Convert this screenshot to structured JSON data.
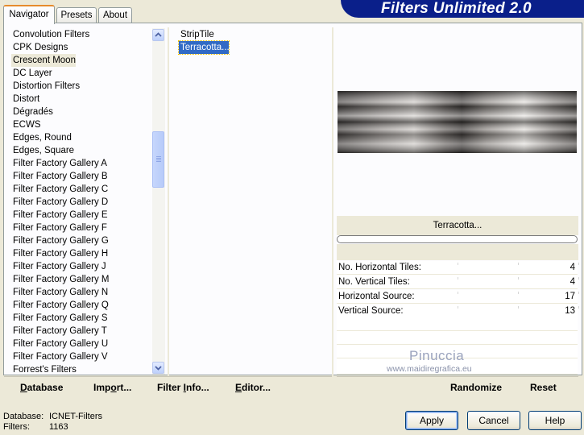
{
  "banner": {
    "title": "Filters Unlimited 2.0"
  },
  "tabs": [
    {
      "label": "Navigator",
      "active": true
    },
    {
      "label": "Presets",
      "active": false
    },
    {
      "label": "About",
      "active": false
    }
  ],
  "categories": {
    "selected": "Crescent Moon",
    "items": [
      "Convolution Filters",
      "CPK Designs",
      "Crescent Moon",
      "DC Layer",
      "Distortion Filters",
      "Distort",
      "Dégradés",
      "ECWS",
      "Edges, Round",
      "Edges, Square",
      "Filter Factory Gallery A",
      "Filter Factory Gallery B",
      "Filter Factory Gallery C",
      "Filter Factory Gallery D",
      "Filter Factory Gallery E",
      "Filter Factory Gallery F",
      "Filter Factory Gallery G",
      "Filter Factory Gallery H",
      "Filter Factory Gallery J",
      "Filter Factory Gallery M",
      "Filter Factory Gallery N",
      "Filter Factory Gallery Q",
      "Filter Factory Gallery S",
      "Filter Factory Gallery T",
      "Filter Factory Gallery U",
      "Filter Factory Gallery V",
      "Forrest's Filters"
    ]
  },
  "filters": {
    "selected": "Terracotta...",
    "items": [
      "StripTile",
      "Terracotta..."
    ]
  },
  "preview": {
    "filter_name": "Terracotta..."
  },
  "params": [
    {
      "label": "No. Horizontal Tiles:",
      "value": "4"
    },
    {
      "label": "No. Vertical Tiles:",
      "value": "4"
    },
    {
      "label": "Horizontal Source:",
      "value": "17"
    },
    {
      "label": "Vertical Source:",
      "value": "13"
    }
  ],
  "watermark": {
    "name": "Pinuccia",
    "url": "www.maidiregrafica.eu"
  },
  "toolbar": {
    "database": {
      "pre": "",
      "key": "D",
      "post": "atabase"
    },
    "import": {
      "pre": "Imp",
      "key": "o",
      "post": "rt..."
    },
    "filter_info": {
      "pre": "Filter ",
      "key": "I",
      "post": "nfo..."
    },
    "editor": {
      "pre": "",
      "key": "E",
      "post": "ditor..."
    },
    "randomize": "Randomize",
    "reset": "Reset"
  },
  "status": {
    "database_label": "Database:",
    "database_value": "ICNET-Filters",
    "filters_label": "Filters:",
    "filters_value": "1163"
  },
  "buttons": {
    "apply": "Apply",
    "cancel": "Cancel",
    "help": "Help"
  }
}
